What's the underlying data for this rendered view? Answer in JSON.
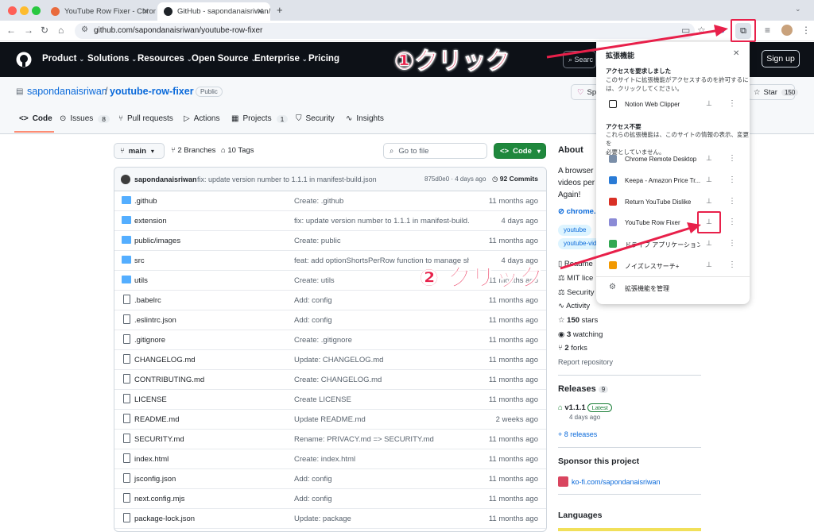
{
  "browser": {
    "tabs": [
      {
        "title": "YouTube Row Fixer - Chrome"
      },
      {
        "title": "GitHub - sapondanaisriwan/yo"
      }
    ],
    "url": "github.com/sapondanaisriwan/youtube-row-fixer"
  },
  "github_nav": {
    "items": [
      "Product",
      "Solutions",
      "Resources",
      "Open Source",
      "Enterprise",
      "Pricing"
    ],
    "search_placeholder": "Searc",
    "signup": "Sign up"
  },
  "repo": {
    "owner": "sapondanaisriwan",
    "separator": "/",
    "name": "youtube-row-fixer",
    "visibility": "Public",
    "sponsor_label": "Sp",
    "star_label": "Star",
    "star_count": "150",
    "tabs": [
      {
        "label": "Code",
        "count": ""
      },
      {
        "label": "Issues",
        "count": "8"
      },
      {
        "label": "Pull requests",
        "count": ""
      },
      {
        "label": "Actions",
        "count": ""
      },
      {
        "label": "Projects",
        "count": "1"
      },
      {
        "label": "Security",
        "count": ""
      },
      {
        "label": "Insights",
        "count": ""
      }
    ]
  },
  "filebar": {
    "branch": "main",
    "branches": "2 Branches",
    "tags": "10 Tags",
    "goto_placeholder": "Go to file",
    "code_button": "Code"
  },
  "commit": {
    "author": "sapondanaisriwan",
    "message": "fix: update version number to 1.1.1 in manifest-build.json",
    "sha_time": "875d0e0 · 4 days ago",
    "commits": "92 Commits"
  },
  "files": [
    {
      "type": "folder",
      "name": ".github",
      "message": "Create: .github",
      "time": "11 months ago"
    },
    {
      "type": "folder",
      "name": "extension",
      "message": "fix: update version number to 1.1.1 in manifest-build.json",
      "time": "4 days ago"
    },
    {
      "type": "folder",
      "name": "public/images",
      "message": "Create: public",
      "time": "11 months ago"
    },
    {
      "type": "folder",
      "name": "src",
      "message": "feat: add optionShortsPerRow function to manage sh...",
      "time": "4 days ago"
    },
    {
      "type": "folder",
      "name": "utils",
      "message": "Create: utils",
      "time": "11 months ago"
    },
    {
      "type": "file",
      "name": ".babelrc",
      "message": "Add: config",
      "time": "11 months ago"
    },
    {
      "type": "file",
      "name": ".eslintrc.json",
      "message": "Add: config",
      "time": "11 months ago"
    },
    {
      "type": "file",
      "name": ".gitignore",
      "message": "Create: .gitignore",
      "time": "11 months ago"
    },
    {
      "type": "file",
      "name": "CHANGELOG.md",
      "message": "Update: CHANGELOG.md",
      "time": "11 months ago"
    },
    {
      "type": "file",
      "name": "CONTRIBUTING.md",
      "message": "Create: CHANGELOG.md",
      "time": "11 months ago"
    },
    {
      "type": "file",
      "name": "LICENSE",
      "message": "Create LICENSE",
      "time": "11 months ago"
    },
    {
      "type": "file",
      "name": "README.md",
      "message": "Update README.md",
      "time": "2 weeks ago"
    },
    {
      "type": "file",
      "name": "SECURITY.md",
      "message": "Rename: PRIVACY.md => SECURITY.md",
      "time": "11 months ago"
    },
    {
      "type": "file",
      "name": "index.html",
      "message": "Create: index.html",
      "time": "11 months ago"
    },
    {
      "type": "file",
      "name": "jsconfig.json",
      "message": "Add: config",
      "time": "11 months ago"
    },
    {
      "type": "file",
      "name": "next.config.mjs",
      "message": "Add: config",
      "time": "11 months ago"
    },
    {
      "type": "file",
      "name": "package-lock.json",
      "message": "Update: package",
      "time": "11 months ago"
    }
  ],
  "about": {
    "heading": "About",
    "desc_lines": [
      "A browser",
      "videos per",
      "Again!"
    ],
    "link": "chrome.",
    "topics": [
      "youtube",
      "youtube-vid"
    ],
    "items": [
      "Readme",
      "MIT lice",
      "Security",
      "Activity"
    ],
    "stars": "150",
    "stars_label": "stars",
    "watching": "3",
    "watching_label": "watching",
    "forks": "2",
    "forks_label": "forks",
    "report": "Report repository"
  },
  "releases": {
    "heading": "Releases",
    "count": "9",
    "version": "v1.1.1",
    "latest": "Latest",
    "date": "4 days ago",
    "more": "+ 8 releases"
  },
  "sponsor": {
    "heading": "Sponsor this project",
    "link": "ko-fi.com/sapondanaisriwan"
  },
  "languages": {
    "heading": "Languages"
  },
  "extensions_popup": {
    "title": "拡張機能",
    "access_requested_title": "アクセスを要求しました",
    "access_requested_desc": [
      "このサイトに拡張機能がアクセスするのを許可するに",
      "は、クリックしてください。"
    ],
    "no_access_title": "アクセス不要",
    "no_access_desc": [
      "これらの拡張機能は、このサイトの情報の表示、変更を",
      "必要としていません。"
    ],
    "requested": [
      {
        "name": "Notion Web Clipper",
        "color": "#222222"
      }
    ],
    "extensions": [
      {
        "name": "Chrome Remote Desktop",
        "color": "#7a8ea8"
      },
      {
        "name": "Keepa - Amazon Price Tr...",
        "color": "#2a7bd6"
      },
      {
        "name": "Return YouTube Dislike",
        "color": "#d93025"
      },
      {
        "name": "YouTube Row Fixer",
        "color": "#8b8bd6"
      },
      {
        "name": "ドライブ アプリケーション",
        "color": "#34a853"
      },
      {
        "name": "ノイズレスサーチ+",
        "color": "#f29900"
      }
    ],
    "manage": "拡張機能を管理"
  },
  "annotations": {
    "step1": "①クリック",
    "step2": "② クリック",
    "color": "#e8204a"
  }
}
